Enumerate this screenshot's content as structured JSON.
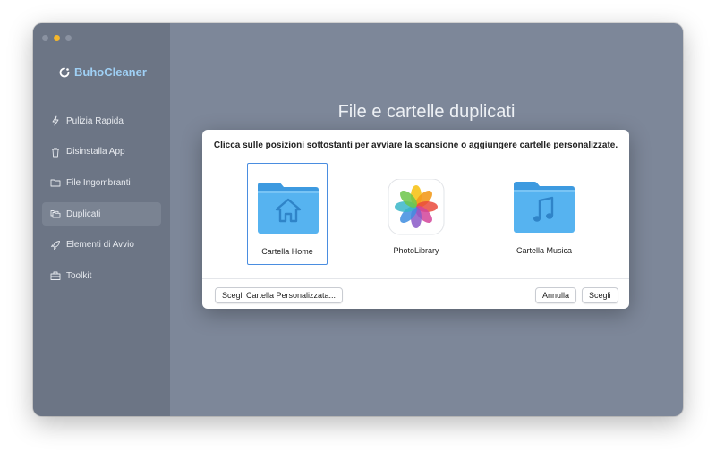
{
  "app": {
    "name": "BuhoCleaner",
    "brand_color": "#9fd0f5"
  },
  "sidebar": {
    "items": [
      {
        "label": "Pulizia Rapida",
        "icon": "lightning-icon",
        "active": false
      },
      {
        "label": "Disinstalla App",
        "icon": "trash-icon",
        "active": false
      },
      {
        "label": "File Ingombranti",
        "icon": "folder-icon",
        "active": false
      },
      {
        "label": "Duplicati",
        "icon": "duplicate-folders-icon",
        "active": true
      },
      {
        "label": "Elementi di Avvio",
        "icon": "rocket-icon",
        "active": false
      },
      {
        "label": "Toolkit",
        "icon": "toolbox-icon",
        "active": false
      }
    ]
  },
  "main": {
    "title": "File e cartelle duplicati"
  },
  "dialog": {
    "message": "Clicca sulle posizioni sottostanti per avviare la scansione o aggiungere cartelle personalizzate.",
    "locations": [
      {
        "label": "Cartella Home",
        "icon": "home-folder-icon",
        "selected": true
      },
      {
        "label": "PhotoLibrary",
        "icon": "photos-app-icon",
        "selected": false
      },
      {
        "label": "Cartella Musica",
        "icon": "music-folder-icon",
        "selected": false
      }
    ],
    "buttons": {
      "custom_folder": "Scegli Cartella Personalizzata...",
      "cancel": "Annulla",
      "choose": "Scegli"
    }
  }
}
